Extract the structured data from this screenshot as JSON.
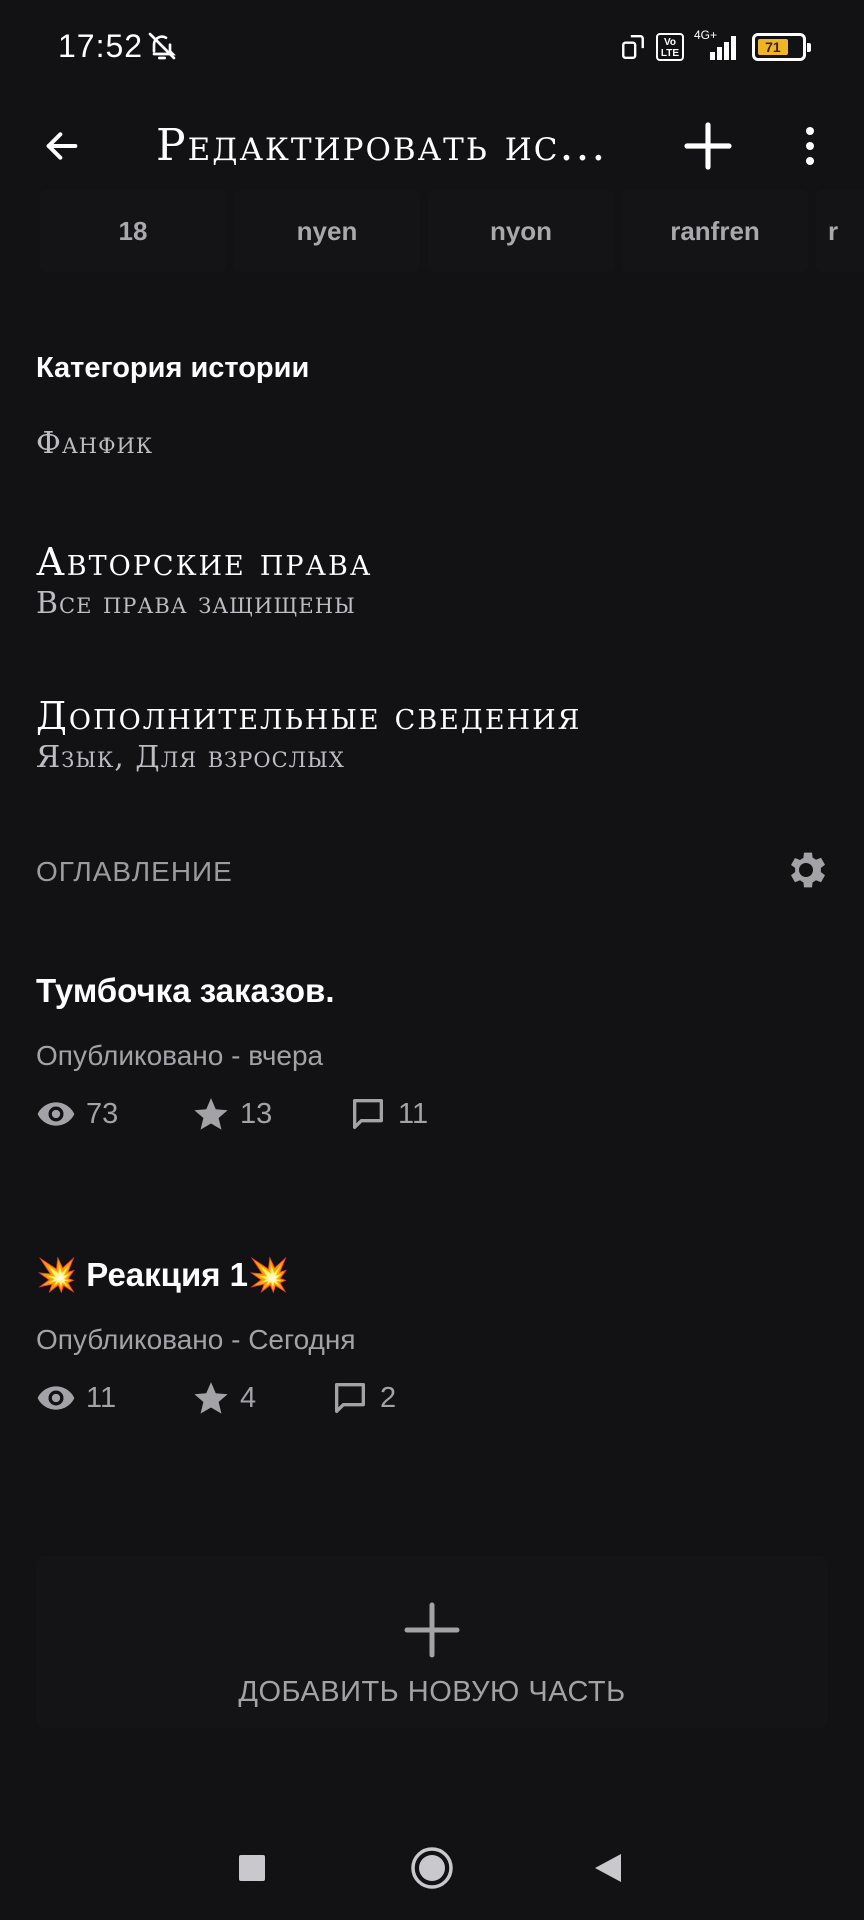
{
  "status_bar": {
    "time": "17:52",
    "network_label": "4G+",
    "battery_level": "71",
    "icons": [
      "bell-off-icon",
      "screen-rotate-icon",
      "volte-icon",
      "signal-icon",
      "battery-icon"
    ]
  },
  "app_bar": {
    "title": "Редактировать ис...",
    "icons": [
      "back-arrow-icon",
      "plus-icon",
      "more-vertical-icon"
    ]
  },
  "tags": [
    "18",
    "nyen",
    "nyon",
    "ranfren",
    "r"
  ],
  "category": {
    "label": "Категория истории",
    "value": "Фанфик"
  },
  "copyright": {
    "heading": "Авторские права",
    "value": "Все права защищены"
  },
  "additional_info": {
    "heading": "Дополнительные сведения",
    "value": "Язык, Для взрослых"
  },
  "toc": {
    "label": "ОГЛАВЛЕНИЕ",
    "settings_icon": "gear-icon"
  },
  "chapters": [
    {
      "title": "Тумбочка заказов.",
      "published": "Опубликовано - вчера",
      "views": "73",
      "votes": "13",
      "comments": "11"
    },
    {
      "title": "💥 Реакция 1💥",
      "published": "Опубликовано - Сегодня",
      "views": "11",
      "votes": "4",
      "comments": "2"
    }
  ],
  "add_part": {
    "label": "ДОБАВИТЬ НОВУЮ ЧАСТЬ",
    "icon": "plus-icon"
  },
  "nav_bar": {
    "icons": [
      "recent-apps-square-icon",
      "home-circle-icon",
      "back-triangle-icon"
    ]
  },
  "colors": {
    "background": "#121114",
    "card": "#141316",
    "text_primary": "#ffffff",
    "text_secondary": "#a3a2a7",
    "battery": "#f0b526"
  }
}
